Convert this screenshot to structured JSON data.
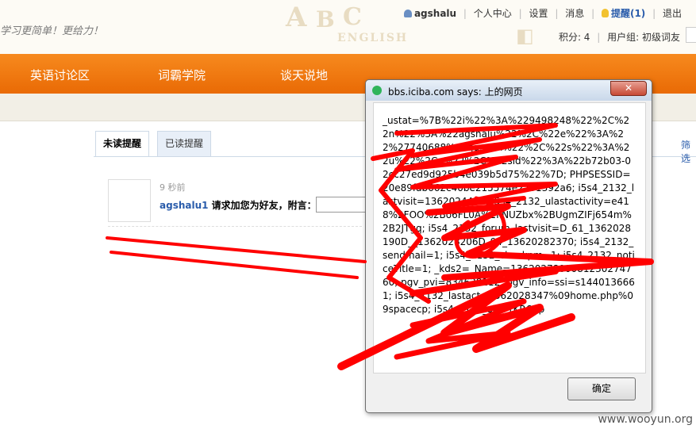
{
  "header": {
    "slogan": "学习更简单！更给力！",
    "deco_text": "ENGLISH",
    "user": {
      "username": "agshalu",
      "links": [
        "个人中心",
        "设置",
        "消息"
      ],
      "remind_label": "提醒(1)",
      "logout_label": "退出",
      "points": "积分: 4",
      "group": "用户组: 初级词友"
    }
  },
  "nav": {
    "items": [
      "英语讨论区",
      "词霸学院",
      "谈天说地"
    ]
  },
  "tabs": {
    "unread": "未读提醒",
    "read": "已读提醒",
    "filter": "筛选"
  },
  "notice": {
    "time": "9 秒前",
    "user": "agshalu1",
    "text": "请求加您为好友，附言："
  },
  "dialog": {
    "title": "bbs.iciba.com says: 上的网页",
    "message": "_ustat=%7B%22i%22%3A%229498248%22%2C%22n%22%3A%22agshalu%22%2C%22e%22%3A%22%27740688%40qq.com%22%2C%22s%22%3A%22u%22%2Ce%22%2C%22sid%22%3A%22b72b03-02cc27ed9d925b4e039b5d75%22%7D; PHPSESSID=20e89fab662c40be215574e2731392a6; i5s4_2132_lastvisit=1362024412; i5s4_2132_ulastactivity=e418%2FOO%2Bo6FL0A%2FNUZbx%2BUgmZIFj654m%2B2JTgq; i5s4_2132_forum_lastvisit=D_61_1362028190D__1362028206D_94_13620282370; i5s4_2132_sendmail=1; i5s4_2132_checkpm=1; i5s4_2132_noticeTitle=1; _kds2=_Name=1362027800081230274760; pgv_pvi=834638112; pgv_info=ssi=s1440136661; i5s4_2132_lastact=1362028347%09home.php%09spacecp; i5s4_2132_sid=rKR6Rp",
    "ok_label": "确定"
  },
  "watermark": "www.wooyun.org",
  "colors": {
    "nav_orange": "#f07a10",
    "link_blue": "#2a5cab",
    "scribble_red": "#ff0000"
  }
}
